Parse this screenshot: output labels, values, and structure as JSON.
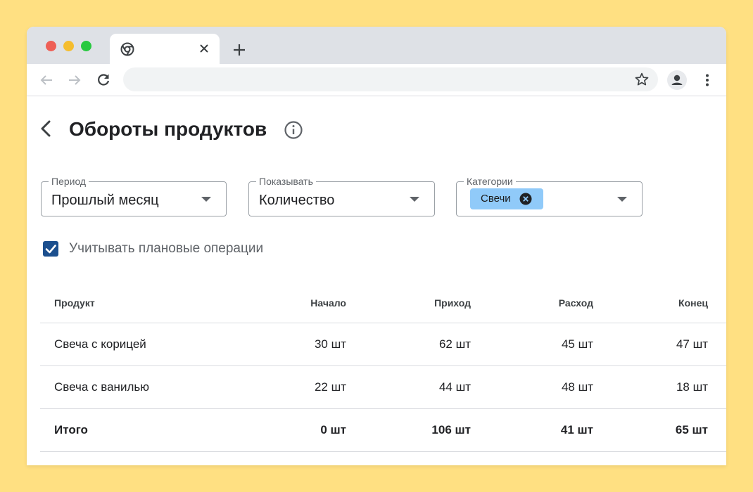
{
  "browser": {
    "tab_close_icon": "close-icon",
    "new_tab_icon": "plus-icon",
    "address_value": ""
  },
  "page": {
    "title": "Обороты продуктов"
  },
  "filters": {
    "period": {
      "label": "Период",
      "value": "Прошлый месяц"
    },
    "show": {
      "label": "Показывать",
      "value": "Количество"
    },
    "categories": {
      "label": "Категории",
      "chips": [
        "Свечи"
      ]
    }
  },
  "checkbox": {
    "label": "Учитывать плановые операции",
    "checked": true
  },
  "table": {
    "headers": [
      "Продукт",
      "Начало",
      "Приход",
      "Расход",
      "Конец"
    ],
    "rows": [
      [
        "Свеча с корицей",
        "30 шт",
        "62 шт",
        "45 шт",
        "47 шт"
      ],
      [
        "Свеча с ванилью",
        "22 шт",
        "44 шт",
        "48 шт",
        "18 шт"
      ]
    ],
    "total": [
      "Итого",
      "0 шт",
      "106 шт",
      "41 шт",
      "65 шт"
    ]
  },
  "colors": {
    "background": "#FFE082",
    "chip": "#90CAF9",
    "checkbox": "#1B4F8E"
  }
}
